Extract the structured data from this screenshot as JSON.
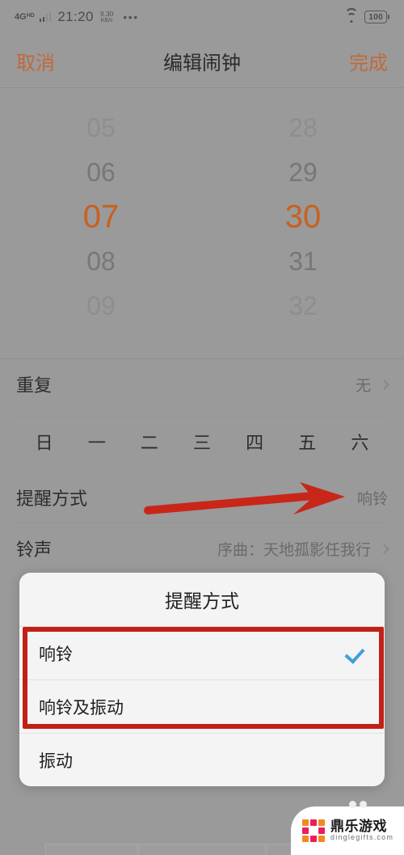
{
  "statusbar": {
    "network_type": "4G",
    "network_sup": "HD",
    "clock": "21:20",
    "netspeed_value": "9.30",
    "netspeed_unit": "KB/s",
    "more_dots": "•••",
    "wifi_icon": "wifi-icon",
    "battery_level": "100"
  },
  "header": {
    "cancel_label": "取消",
    "title": "编辑闹钟",
    "done_label": "完成",
    "accent_color": "#c06a3a"
  },
  "picker": {
    "hours": [
      "05",
      "06",
      "07",
      "08",
      "09"
    ],
    "minutes": [
      "28",
      "29",
      "30",
      "31",
      "32"
    ],
    "selected_hour": "07",
    "selected_minute": "30",
    "selected_color": "#c8601f"
  },
  "rows": {
    "repeat": {
      "label": "重复",
      "value": "无"
    },
    "reminder": {
      "label": "提醒方式",
      "value": "响铃"
    },
    "ringtone": {
      "label": "铃声",
      "value": "序曲：天地孤影任我行"
    }
  },
  "weekdays": [
    "日",
    "一",
    "二",
    "三",
    "四",
    "五",
    "六"
  ],
  "dialog": {
    "title": "提醒方式",
    "options": [
      {
        "label": "响铃",
        "checked": true
      },
      {
        "label": "响铃及振动",
        "checked": false
      },
      {
        "label": "振动",
        "checked": false
      }
    ],
    "check_color": "#3f9fdd"
  },
  "annotations": {
    "arrow_color": "#c9261a",
    "box_color": "#c22017"
  },
  "watermark": {
    "name_cn": "鼎乐游戏",
    "name_en": "dinglegifts.com",
    "colors": [
      "#f5871f",
      "#ec1c5e",
      "#f5871f",
      "#ec1c5e",
      "#ffffff",
      "#ec1c5e",
      "#f5871f",
      "#ec1c5e",
      "#f5871f"
    ]
  }
}
